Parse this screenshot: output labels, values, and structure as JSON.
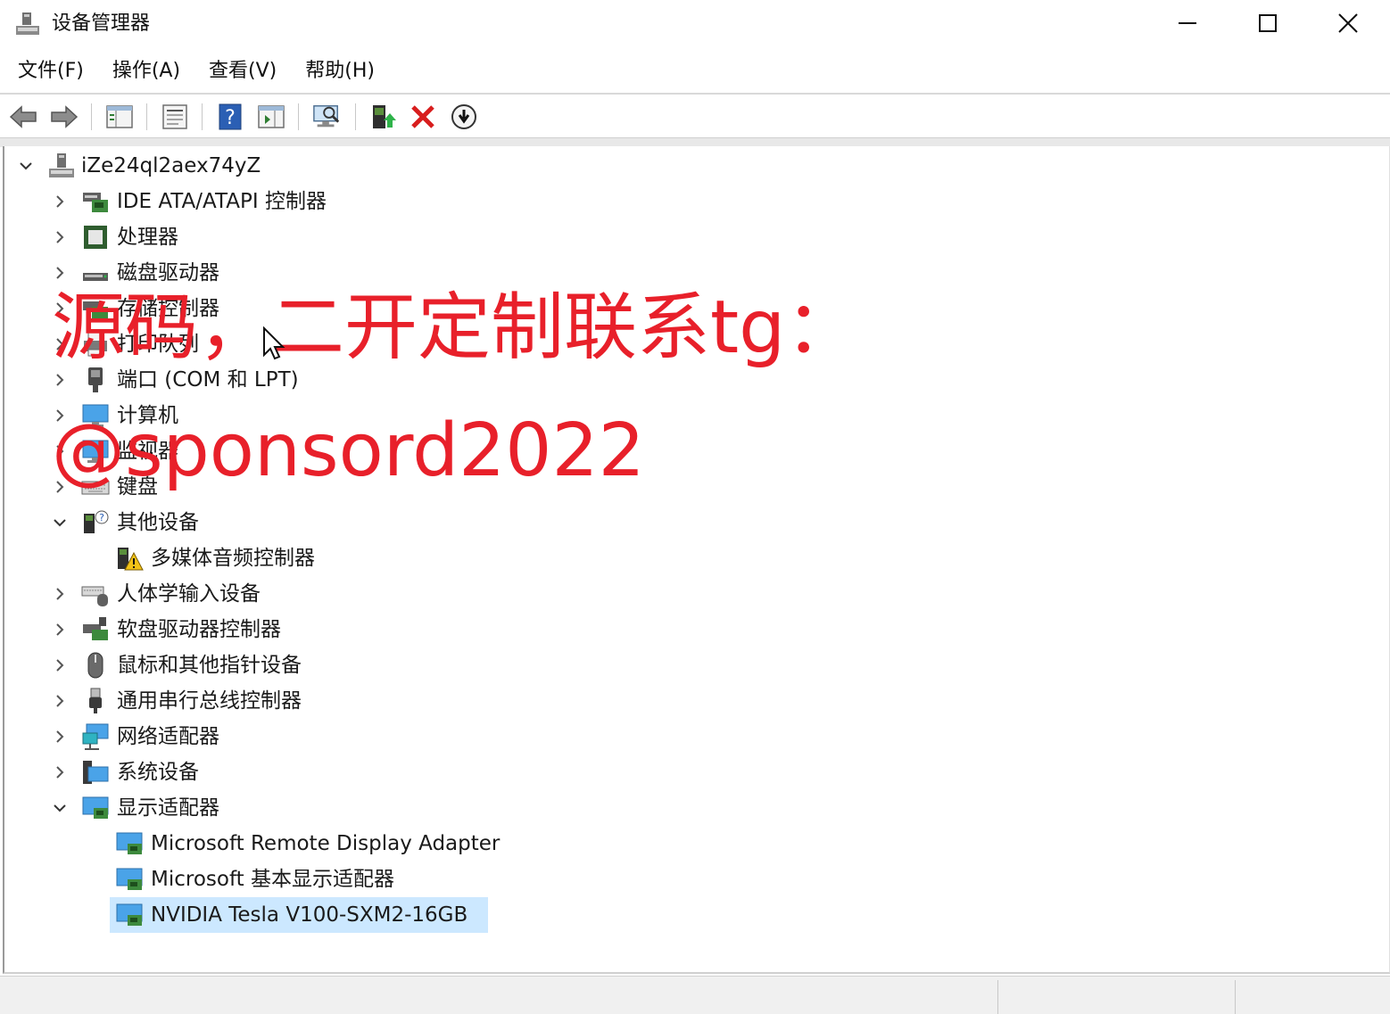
{
  "window": {
    "title": "设备管理器",
    "controls": {
      "minimize": "minimize",
      "maximize": "maximize",
      "close": "close"
    }
  },
  "menu": [
    "文件(F)",
    "操作(A)",
    "查看(V)",
    "帮助(H)"
  ],
  "toolbar": {
    "buttons": [
      "back-icon",
      "forward-icon",
      "show-hide-tree-icon",
      "properties-icon",
      "help-icon",
      "action-pane-icon",
      "scan-hardware-icon",
      "update-driver-icon",
      "uninstall-icon",
      "disable-icon"
    ],
    "colors": {
      "uninstall": "#d81e1e",
      "help": "#2b5fb4"
    }
  },
  "tree": {
    "root": "iZe24ql2aex74yZ",
    "categories": [
      {
        "label": "IDE ATA/ATAPI 控制器",
        "expanded": false,
        "icon": "ide-controller-icon"
      },
      {
        "label": "处理器",
        "expanded": false,
        "icon": "processor-icon"
      },
      {
        "label": "磁盘驱动器",
        "expanded": false,
        "icon": "disk-drive-icon"
      },
      {
        "label": "存储控制器",
        "expanded": false,
        "icon": "storage-controller-icon"
      },
      {
        "label": "打印队列",
        "expanded": false,
        "icon": "print-queue-icon"
      },
      {
        "label": "端口 (COM 和 LPT)",
        "expanded": false,
        "icon": "port-icon"
      },
      {
        "label": "计算机",
        "expanded": false,
        "icon": "computer-icon"
      },
      {
        "label": "监视器",
        "expanded": false,
        "icon": "monitor-icon"
      },
      {
        "label": "键盘",
        "expanded": false,
        "icon": "keyboard-icon"
      },
      {
        "label": "其他设备",
        "expanded": true,
        "icon": "other-devices-icon",
        "children": [
          {
            "label": "多媒体音频控制器",
            "icon": "warning-device-icon"
          }
        ]
      },
      {
        "label": "人体学输入设备",
        "expanded": false,
        "icon": "hid-icon"
      },
      {
        "label": "软盘驱动器控制器",
        "expanded": false,
        "icon": "floppy-controller-icon"
      },
      {
        "label": "鼠标和其他指针设备",
        "expanded": false,
        "icon": "mouse-icon"
      },
      {
        "label": "通用串行总线控制器",
        "expanded": false,
        "icon": "usb-icon"
      },
      {
        "label": "网络适配器",
        "expanded": false,
        "icon": "network-adapter-icon"
      },
      {
        "label": "系统设备",
        "expanded": false,
        "icon": "system-device-icon"
      },
      {
        "label": "显示适配器",
        "expanded": true,
        "icon": "display-adapter-icon",
        "children": [
          {
            "label": "Microsoft Remote Display Adapter",
            "icon": "display-adapter-icon"
          },
          {
            "label": "Microsoft 基本显示适配器",
            "icon": "display-adapter-icon"
          },
          {
            "label": "NVIDIA Tesla V100-SXM2-16GB",
            "icon": "display-adapter-icon",
            "selected": true
          }
        ]
      }
    ]
  },
  "watermark": {
    "line1": "源码，二开定制联系tg：",
    "line2": "@sponsord2022",
    "color": "#e8202a"
  },
  "colors": {
    "selection": "#cce8ff",
    "accent": "#2b5fb4"
  }
}
